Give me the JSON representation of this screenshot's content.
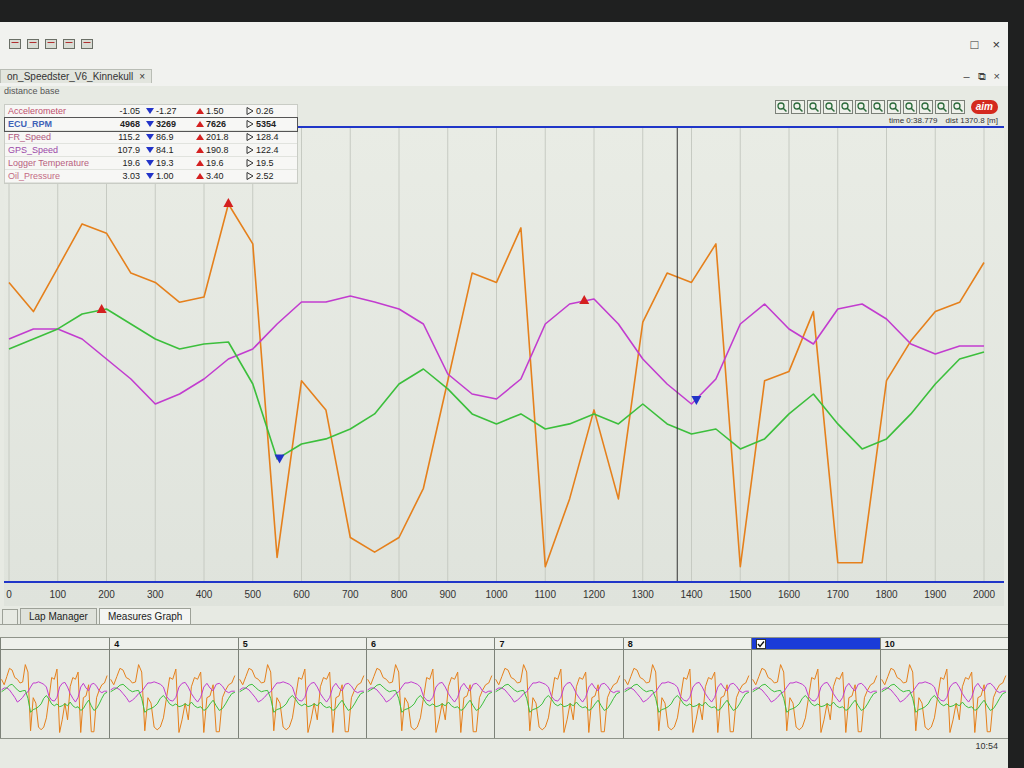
{
  "window": {
    "title": "on_Speedster_V6_Kinnekull",
    "close": "×",
    "subtitle": "distance base",
    "controls": [
      "□",
      "×"
    ],
    "doc_controls": [
      "–",
      "⧉",
      "×"
    ]
  },
  "toolbar": {
    "logo": "aim"
  },
  "readout": {
    "time": "time 0:38.779",
    "dist": "dist 1370.8 [m]"
  },
  "channels": [
    {
      "name": "Accelerometer",
      "value": "-1.05",
      "min": "-1.27",
      "max": "1.50",
      "avg": "0.26",
      "color": "#c0506e",
      "selected": false
    },
    {
      "name": "ECU_RPM",
      "value": "4968",
      "min": "3269",
      "max": "7626",
      "avg": "5354",
      "color": "#3f62b8",
      "selected": true
    },
    {
      "name": "FR_Speed",
      "value": "115.2",
      "min": "86.9",
      "max": "201.8",
      "avg": "128.4",
      "color": "#b0587e",
      "selected": false
    },
    {
      "name": "GPS_Speed",
      "value": "107.9",
      "min": "84.1",
      "max": "190.8",
      "avg": "122.4",
      "color": "#9a48a8",
      "selected": false
    },
    {
      "name": "Logger Temperature",
      "value": "19.6",
      "min": "19.3",
      "max": "19.6",
      "avg": "19.5",
      "color": "#b8607e",
      "selected": false
    },
    {
      "name": "Oil_Pressure",
      "value": "3.03",
      "min": "1.00",
      "max": "3.40",
      "avg": "2.52",
      "color": "#c46a84",
      "selected": false
    }
  ],
  "chart": {
    "x_ticks": [
      "0",
      "100",
      "200",
      "300",
      "400",
      "500",
      "600",
      "700",
      "800",
      "900",
      "1000",
      "1100",
      "1200",
      "1300",
      "1400",
      "1500",
      "1600",
      "1700",
      "1800",
      "1900",
      "2000"
    ],
    "x_start": 0,
    "x_step": 50,
    "series": [
      {
        "channel": "Accelerometer",
        "color": "#e5801c",
        "values": [
          0.91,
          0.69,
          1.02,
          1.35,
          1.28,
          0.98,
          0.91,
          0.76,
          0.8,
          1.5,
          1.2,
          -1.16,
          0.17,
          -0.05,
          -1.01,
          -1.12,
          -1.01,
          -0.64,
          0.17,
          0.98,
          0.91,
          1.32,
          -1.23,
          -0.72,
          -0.05,
          -0.72,
          0.61,
          0.98,
          0.91,
          1.2,
          -1.23,
          0.17,
          0.24,
          0.69,
          -1.2,
          -1.2,
          0.17,
          0.47,
          0.69,
          0.76,
          1.06
        ]
      },
      {
        "channel": "ECU_RPM",
        "color": "#c23ccf",
        "values": [
          5811,
          6174,
          6174,
          5811,
          5085,
          4359,
          3451,
          3814,
          4359,
          5085,
          5448,
          6355,
          7154,
          7154,
          7372,
          7154,
          6900,
          6355,
          4540,
          3814,
          3633,
          4359,
          6355,
          7081,
          7263,
          6355,
          5085,
          4177,
          3451,
          4359,
          6355,
          7081,
          6174,
          5629,
          6900,
          7081,
          6537,
          5629,
          5266,
          5557,
          5557
        ]
      },
      {
        "channel": "GPS_Speed",
        "color": "#3cbf3c",
        "values": [
          161.9,
          168.8,
          175.7,
          186.0,
          189.4,
          179.1,
          168.8,
          161.9,
          165.3,
          166.7,
          137.8,
          86.2,
          96.5,
          100.0,
          106.8,
          117.2,
          137.8,
          148.1,
          134.4,
          117.2,
          110.3,
          117.2,
          106.8,
          110.3,
          117.2,
          110.3,
          124.0,
          110.3,
          103.4,
          106.8,
          93.1,
          100.0,
          117.2,
          130.9,
          110.3,
          93.1,
          100.0,
          117.2,
          137.8,
          155.0,
          159.8
        ]
      }
    ],
    "markers": [
      {
        "channel": "GPS_Speed",
        "at": 190,
        "kind": "max"
      },
      {
        "channel": "GPS_Speed",
        "at": 555,
        "kind": "min"
      },
      {
        "channel": "Accelerometer",
        "at": 450,
        "kind": "max"
      },
      {
        "channel": "ECU_RPM",
        "at": 1180,
        "kind": "max"
      },
      {
        "channel": "ECU_RPM",
        "at": 1410,
        "kind": "min"
      }
    ],
    "cursor": 1370.8
  },
  "tabs": [
    {
      "label": "Lap Manager",
      "selected": false
    },
    {
      "label": "Measures Graph",
      "selected": true
    }
  ],
  "laps": [
    {
      "label": "",
      "selected": false,
      "checked": false
    },
    {
      "label": "4",
      "selected": false,
      "checked": false
    },
    {
      "label": "5",
      "selected": false,
      "checked": false
    },
    {
      "label": "6",
      "selected": false,
      "checked": false
    },
    {
      "label": "7",
      "selected": false,
      "checked": false
    },
    {
      "label": "8",
      "selected": false,
      "checked": false
    },
    {
      "label": "",
      "selected": true,
      "checked": true
    },
    {
      "label": "10",
      "selected": false,
      "checked": false
    }
  ],
  "status": {
    "clock": "10:54"
  }
}
